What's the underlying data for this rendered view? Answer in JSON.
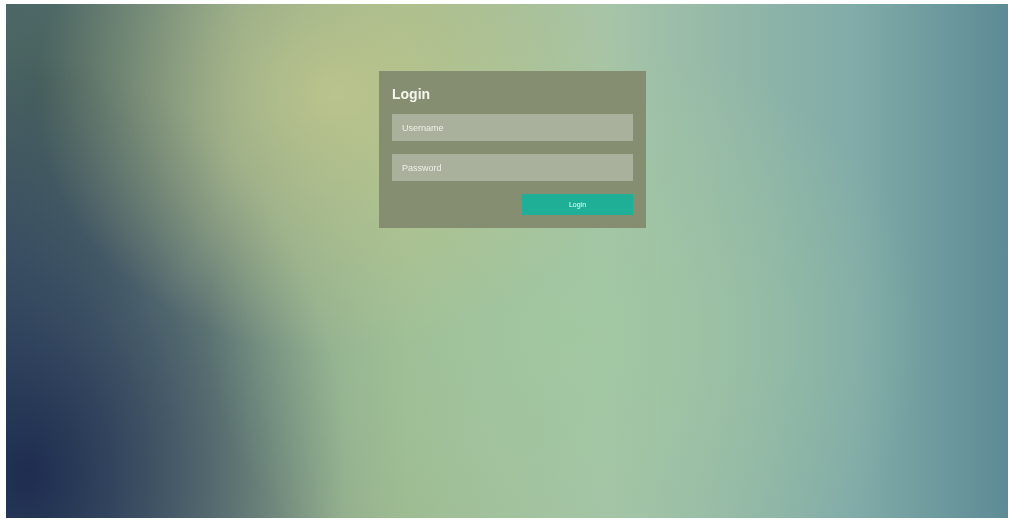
{
  "login_form": {
    "title": "Login",
    "username": {
      "placeholder": "Username"
    },
    "password": {
      "placeholder": "Password"
    },
    "button": "Login"
  }
}
